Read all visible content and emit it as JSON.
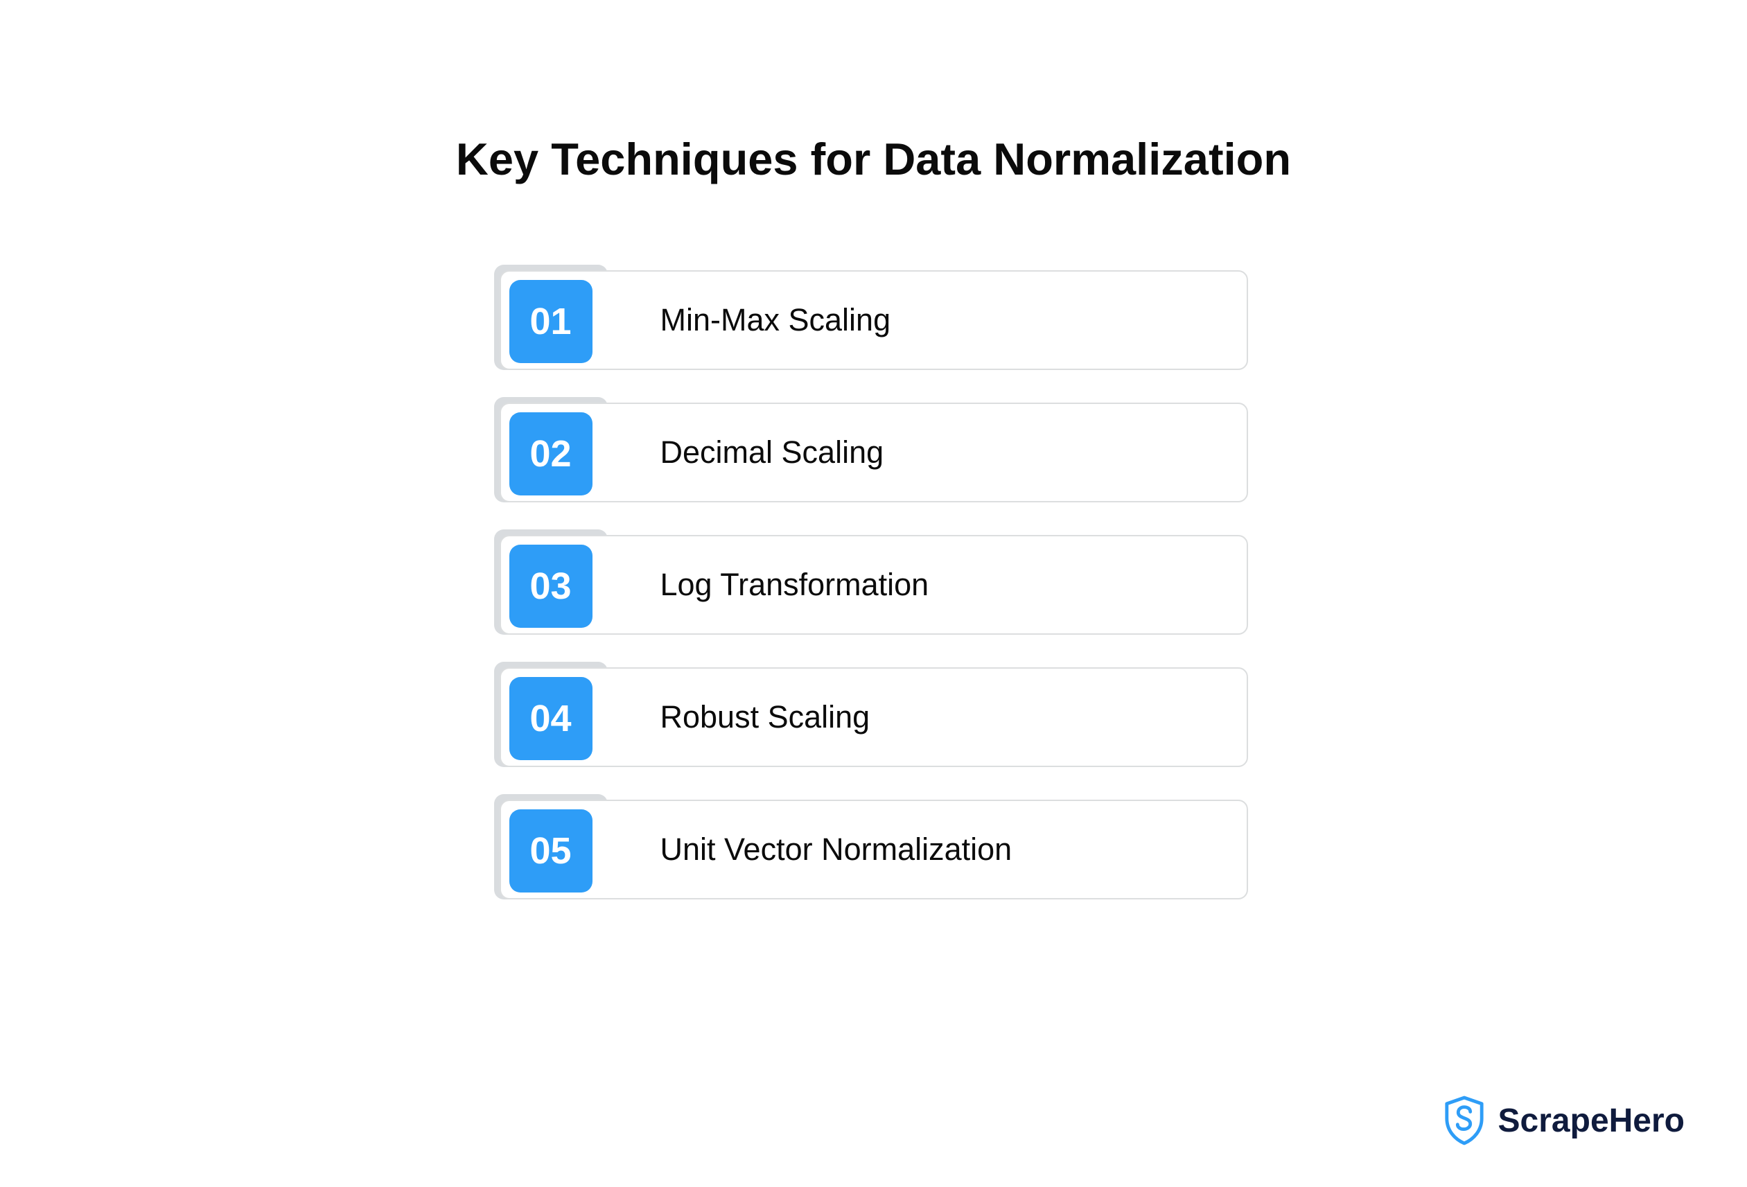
{
  "title": "Key Techniques for Data Normalization",
  "colors": {
    "badge_bg": "#2e9df7",
    "badge_text": "#ffffff",
    "border": "#dcdedf",
    "shadow": "#d9dcdf",
    "brand": "#2e9df7",
    "brand_text": "#0f1b3d"
  },
  "items": [
    {
      "num": "01",
      "label": "Min-Max Scaling"
    },
    {
      "num": "02",
      "label": "Decimal Scaling"
    },
    {
      "num": "03",
      "label": "Log Transformation"
    },
    {
      "num": "04",
      "label": "Robust Scaling"
    },
    {
      "num": "05",
      "label": "Unit Vector Normalization"
    }
  ],
  "brand": {
    "name": "ScrapeHero",
    "icon": "shield-s-icon"
  }
}
